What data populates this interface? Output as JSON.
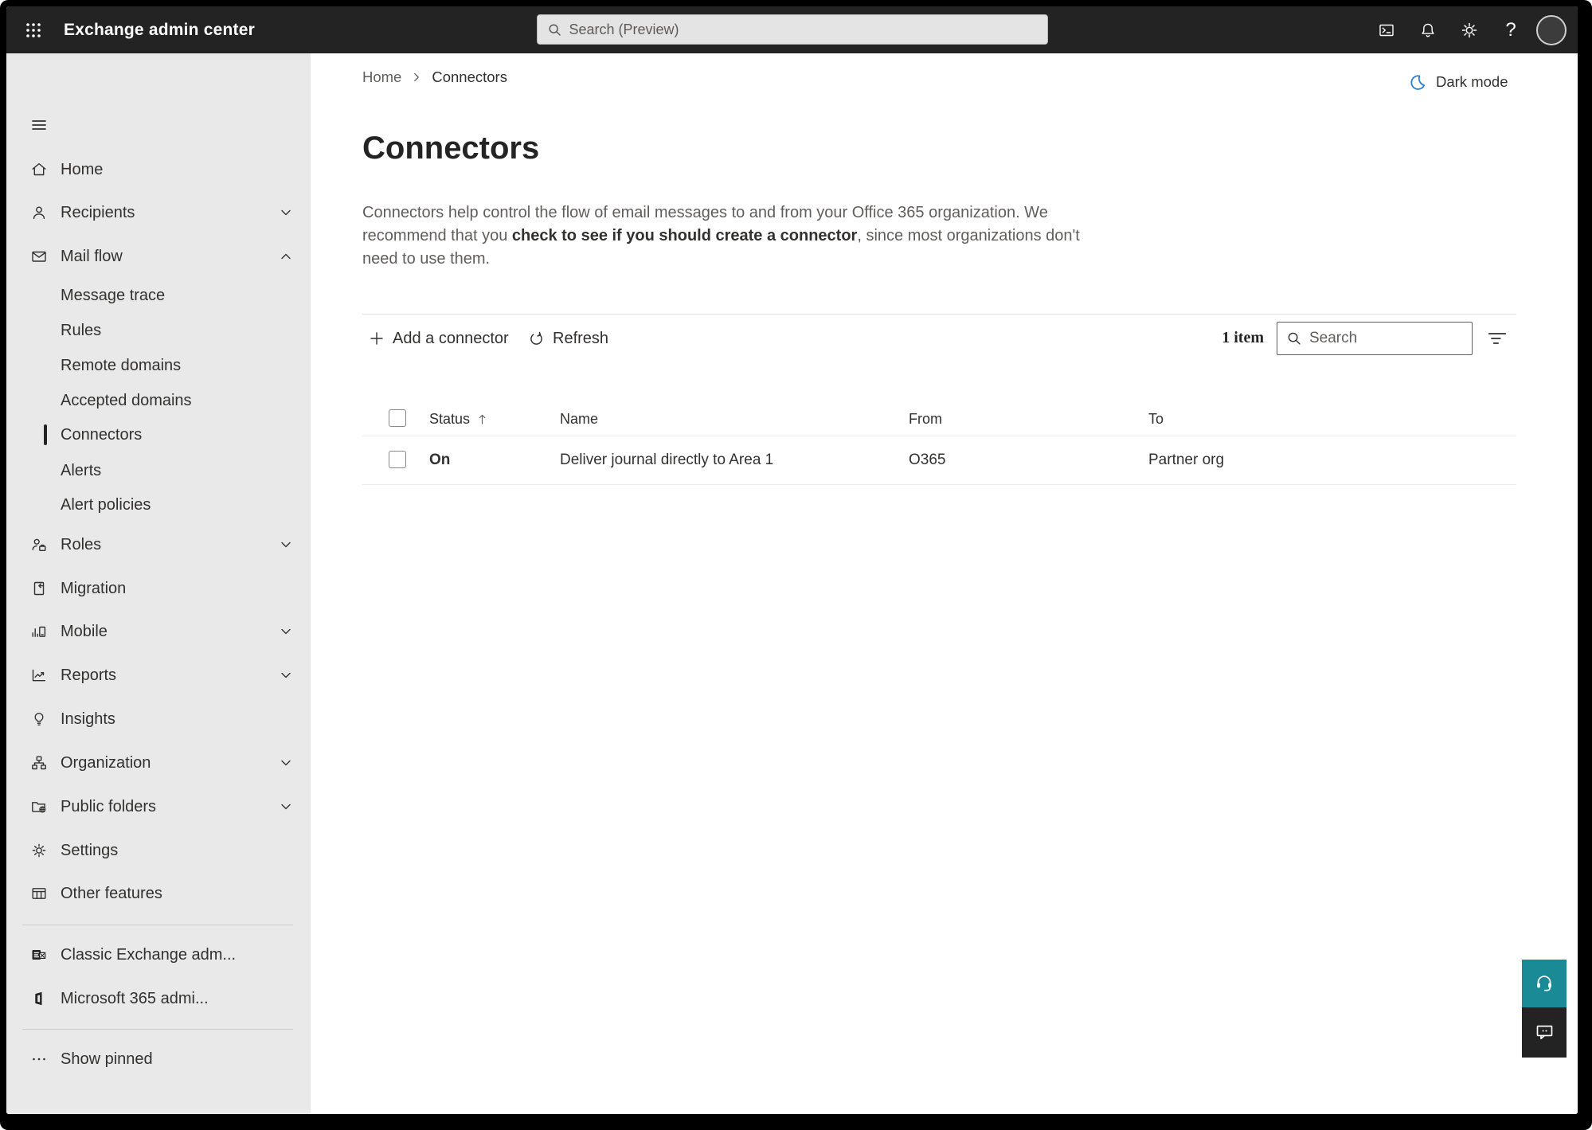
{
  "topbar": {
    "title": "Exchange admin center",
    "search_placeholder": "Search (Preview)"
  },
  "sidebar": {
    "items": [
      {
        "label": "Home"
      },
      {
        "label": "Recipients"
      },
      {
        "label": "Mail flow"
      },
      {
        "label": "Message trace"
      },
      {
        "label": "Rules"
      },
      {
        "label": "Remote domains"
      },
      {
        "label": "Accepted domains"
      },
      {
        "label": "Connectors"
      },
      {
        "label": "Alerts"
      },
      {
        "label": "Alert policies"
      },
      {
        "label": "Roles"
      },
      {
        "label": "Migration"
      },
      {
        "label": "Mobile"
      },
      {
        "label": "Reports"
      },
      {
        "label": "Insights"
      },
      {
        "label": "Organization"
      },
      {
        "label": "Public folders"
      },
      {
        "label": "Settings"
      },
      {
        "label": "Other features"
      }
    ],
    "footer_items": [
      {
        "label": "Classic Exchange adm..."
      },
      {
        "label": "Microsoft 365 admi..."
      }
    ],
    "show_pinned_label": "Show pinned"
  },
  "breadcrumb": {
    "home": "Home",
    "current": "Connectors"
  },
  "header": {
    "dark_mode_label": "Dark mode"
  },
  "page": {
    "title": "Connectors",
    "description": {
      "part1": "Connectors help control the flow of email messages to and from your Office 365 organization. We recommend that you ",
      "part2": "check to see if you should create a connector",
      "part3": ", since most organizations don't need to use them."
    }
  },
  "toolbar": {
    "add_label": "Add a connector",
    "refresh_label": "Refresh",
    "item_count": "1 item",
    "search_placeholder": "Search"
  },
  "table": {
    "columns": {
      "status": "Status",
      "name": "Name",
      "from": "From",
      "to": "To"
    },
    "rows": [
      {
        "status": "On",
        "name": "Deliver journal directly to Area 1",
        "from": "O365",
        "to": "Partner org"
      }
    ]
  },
  "colors": {
    "topbar_bg": "#232323",
    "sidebar_bg": "#e9e9e9",
    "accent_blue": "#2b7cd3",
    "help_teal": "#1a8a96",
    "chat_dark": "#242323",
    "text_primary": "#323130",
    "text_secondary": "#605e5c"
  },
  "icons": {
    "app-launcher-icon": "3x3 dot grid",
    "terminal-icon": "powershell window",
    "bell-icon": "notifications",
    "gear-icon": "settings",
    "help-icon": "?",
    "moon-icon": "crescent",
    "headset-icon": "support",
    "chat-icon": "feedback bubble",
    "filter-icon": "three decreasing lines",
    "sort-ascending-icon": "up arrow"
  }
}
